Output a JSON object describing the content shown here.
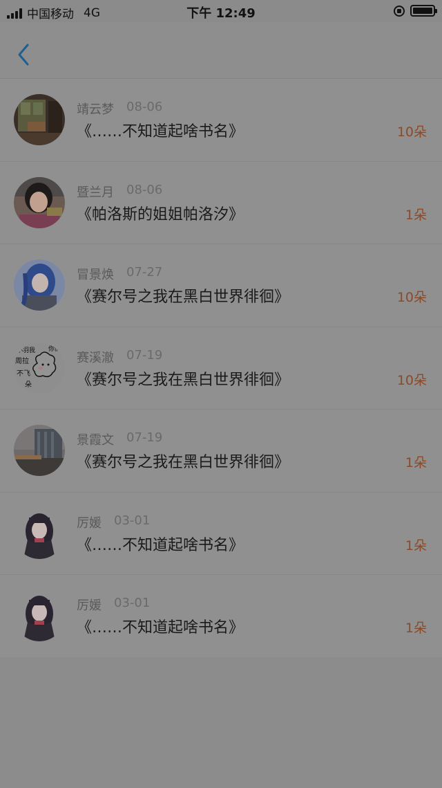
{
  "status_bar": {
    "carrier": "中国移动",
    "network": "4G",
    "time": "下午 12:49"
  },
  "header": {
    "back_icon": "chevron-left-icon"
  },
  "rows": [
    {
      "name": "靖云梦",
      "date": "08-06",
      "book": "《……不知道起啥书名》",
      "count": "10朵"
    },
    {
      "name": "暨兰月",
      "date": "08-06",
      "book": "《帕洛斯的姐姐帕洛汐》",
      "count": "1朵"
    },
    {
      "name": "冒景焕",
      "date": "07-27",
      "book": "《赛尔号之我在黑白世界徘徊》",
      "count": "10朵"
    },
    {
      "name": "赛溪澈",
      "date": "07-19",
      "book": "《赛尔号之我在黑白世界徘徊》",
      "count": "10朵"
    },
    {
      "name": "景霞文",
      "date": "07-19",
      "book": "《赛尔号之我在黑白世界徘徊》",
      "count": "1朵"
    },
    {
      "name": "厉媛",
      "date": "03-01",
      "book": "《……不知道起啥书名》",
      "count": "1朵"
    },
    {
      "name": "厉媛",
      "date": "03-01",
      "book": "《……不知道起啥书名》",
      "count": "1朵"
    }
  ],
  "avatar_doodle_text": "小羽我你们要周拉不飞朵",
  "colors": {
    "accent_blue": "#1f5f8e",
    "count_color": "#8a4a28"
  }
}
